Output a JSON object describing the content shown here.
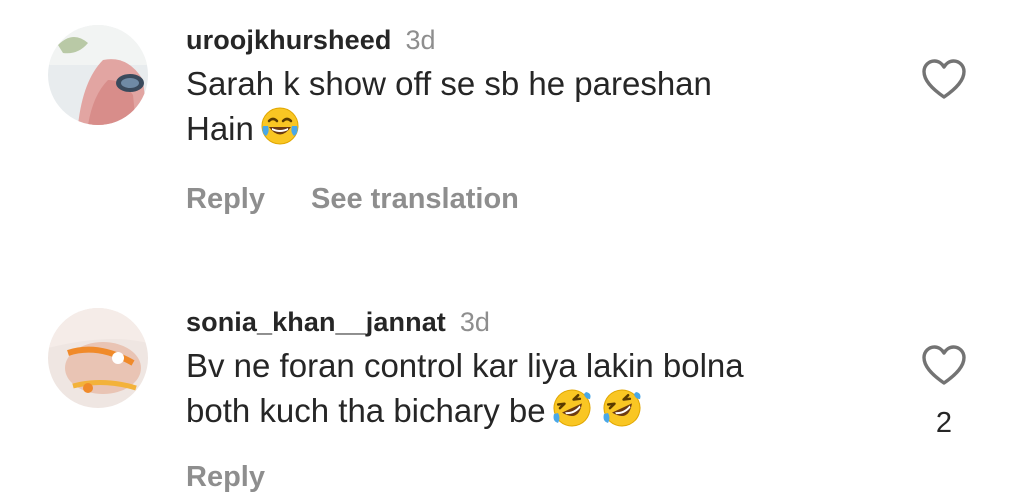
{
  "comments": [
    {
      "username": "uroojkhursheed",
      "time": "3d",
      "text_line1": "Sarah k show off se sb he pareshan",
      "text_line2": "Hain",
      "emoji": [
        "face-with-tears-of-joy"
      ],
      "actions": {
        "reply": "Reply",
        "translate": "See translation"
      },
      "likes": ""
    },
    {
      "username": "sonia_khan__jannat",
      "time": "3d",
      "text_line1": "Bv ne foran control kar liya lakin bolna",
      "text_line2": "both kuch tha bichary be",
      "emoji": [
        "rolling-on-the-floor-laughing",
        "rolling-on-the-floor-laughing"
      ],
      "actions": {
        "reply": "Reply"
      },
      "likes": "2"
    }
  ],
  "colors": {
    "text": "#262626",
    "secondary": "#8e8e8e",
    "background": "#ffffff"
  }
}
